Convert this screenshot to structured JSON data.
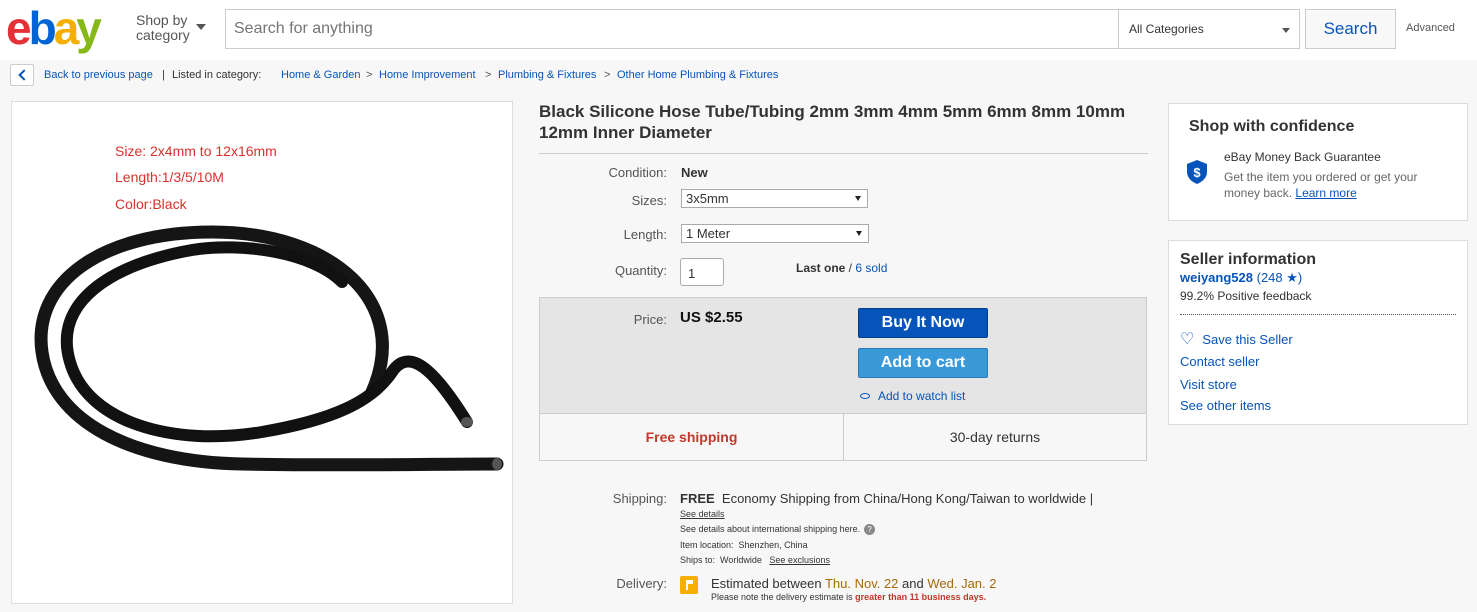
{
  "header": {
    "logo": [
      "e",
      "b",
      "a",
      "y"
    ],
    "shop_by_line1": "Shop by",
    "shop_by_line2": "category",
    "search_placeholder": "Search for anything",
    "category_selected": "All Categories",
    "search_button": "Search",
    "advanced": "Advanced"
  },
  "breadcrumb": {
    "back": "Back to previous page",
    "listed_in": "Listed in category:",
    "items": [
      "Home & Garden",
      "Home Improvement",
      "Plumbing & Fixtures",
      "Other Home Plumbing & Fixtures"
    ],
    "separator": ">"
  },
  "image": {
    "lines": [
      "Size: 2x4mm to 12x16mm",
      "Length:1/3/5/10M",
      "Color:Black"
    ]
  },
  "item": {
    "title": "Black Silicone Hose Tube/Tubing 2mm 3mm 4mm 5mm 6mm 8mm 10mm 12mm Inner Diameter",
    "condition_label": "Condition:",
    "condition": "New",
    "sizes_label": "Sizes:",
    "sizes_selected": "3x5mm",
    "length_label": "Length:",
    "length_selected": "1 Meter",
    "quantity_label": "Quantity:",
    "quantity": "1",
    "last_one": "Last one",
    "availability_sep": " / ",
    "sold": "6 sold",
    "price_label": "Price:",
    "price": "US $2.55",
    "buy_now": "Buy It Now",
    "add_to_cart": "Add to cart",
    "watch": "Add to watch list",
    "free_shipping": "Free shipping",
    "returns": "30-day returns"
  },
  "shipping": {
    "label": "Shipping:",
    "free": "FREE",
    "desc": "Economy Shipping from China/Hong Kong/Taiwan to worldwide |",
    "see_details": "See details",
    "intl_note": "See details about international shipping here.",
    "location_label": "Item location:",
    "location": "Shenzhen, China",
    "ships_to_label": "Ships to:",
    "ships_to": "Worldwide",
    "see_exclusions": "See exclusions",
    "delivery_label": "Delivery:",
    "est_prefix": "Estimated between ",
    "est_start": "Thu. Nov. 22",
    "est_and": " and ",
    "est_end": "Wed. Jan. 2",
    "note_prefix": "Please note the delivery estimate is ",
    "note_hl": "greater than 11 business days."
  },
  "confidence": {
    "title": "Shop with confidence",
    "guarantee": "eBay Money Back Guarantee",
    "desc": "Get the item you ordered or get your money back.",
    "learn_more": "Learn more"
  },
  "seller": {
    "title": "Seller information",
    "name": "weiyang528",
    "score": "(248 ★)",
    "feedback": "99.2% Positive feedback",
    "save": "Save this Seller",
    "contact": "Contact seller",
    "store": "Visit store",
    "other": "See other items"
  },
  "colors": {
    "brand_blue": "#0654ba",
    "cart_blue": "#3a9ad9",
    "red_text": "#d9322c",
    "gold": "#a6690a"
  }
}
